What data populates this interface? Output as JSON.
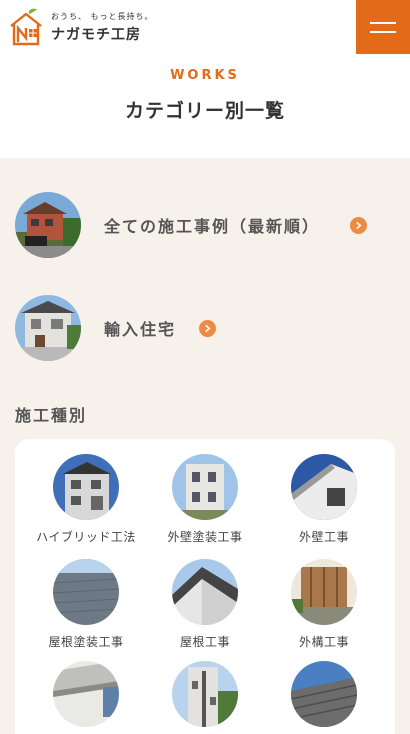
{
  "header": {
    "tagline": "おうち、 もっと長持ち。",
    "brand": "ナガモチ工房",
    "menu_icon": "hamburger-icon"
  },
  "heading": {
    "section_en": "WORKS",
    "title": "カテゴリー別一覧"
  },
  "categories": [
    {
      "label": "全ての施工事例（最新順）",
      "icon": "arrow-right-circle-icon"
    },
    {
      "label": "輸入住宅",
      "icon": "arrow-right-circle-icon"
    }
  ],
  "construction_types": {
    "title": "施工種別",
    "items": [
      {
        "label": "ハイブリッド工法"
      },
      {
        "label": "外壁塗装工事"
      },
      {
        "label": "外壁工事"
      },
      {
        "label": "屋根塗装工事"
      },
      {
        "label": "屋根工事"
      },
      {
        "label": "外構工事"
      },
      {
        "label": ""
      },
      {
        "label": ""
      },
      {
        "label": ""
      }
    ]
  },
  "colors": {
    "accent": "#e26a19",
    "arrow": "#ef8a43",
    "section_bg": "#f6f1eb",
    "card_bg": "#ffffff"
  }
}
